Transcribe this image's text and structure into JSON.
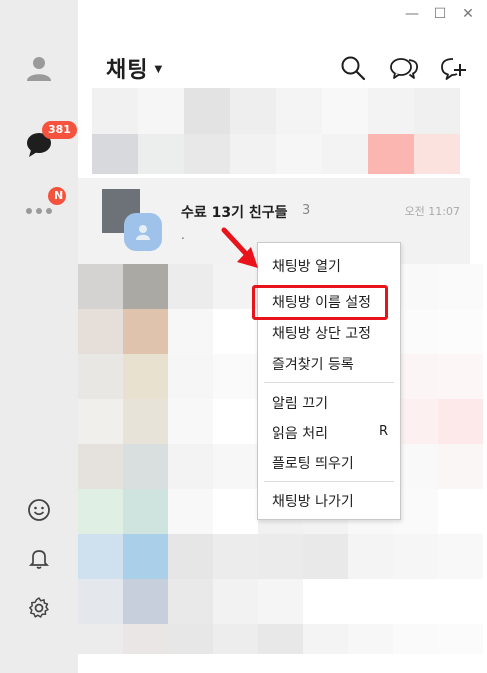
{
  "window": {
    "minimize": "—",
    "maximize": "☐",
    "close": "✕"
  },
  "sidebar": {
    "chat_badge": "381",
    "more_badge": "N"
  },
  "header": {
    "title": "채팅"
  },
  "chat": {
    "name": "수료 13기 친구들",
    "count": "3",
    "time": "오전 11:07",
    "preview": "."
  },
  "menu": {
    "open": "채팅방 열기",
    "rename": "채팅방 이름 설정",
    "pin": "채팅방 상단 고정",
    "favorite": "즐겨찾기 등록",
    "mute": "알림 끄기",
    "read": "읽음 처리",
    "read_shortcut": "R",
    "float": "플로팅 띄우기",
    "leave": "채팅방 나가기"
  },
  "colors": {
    "accent": "#e8131b",
    "badge": "#f5533d",
    "sidebar": "#ececec"
  }
}
